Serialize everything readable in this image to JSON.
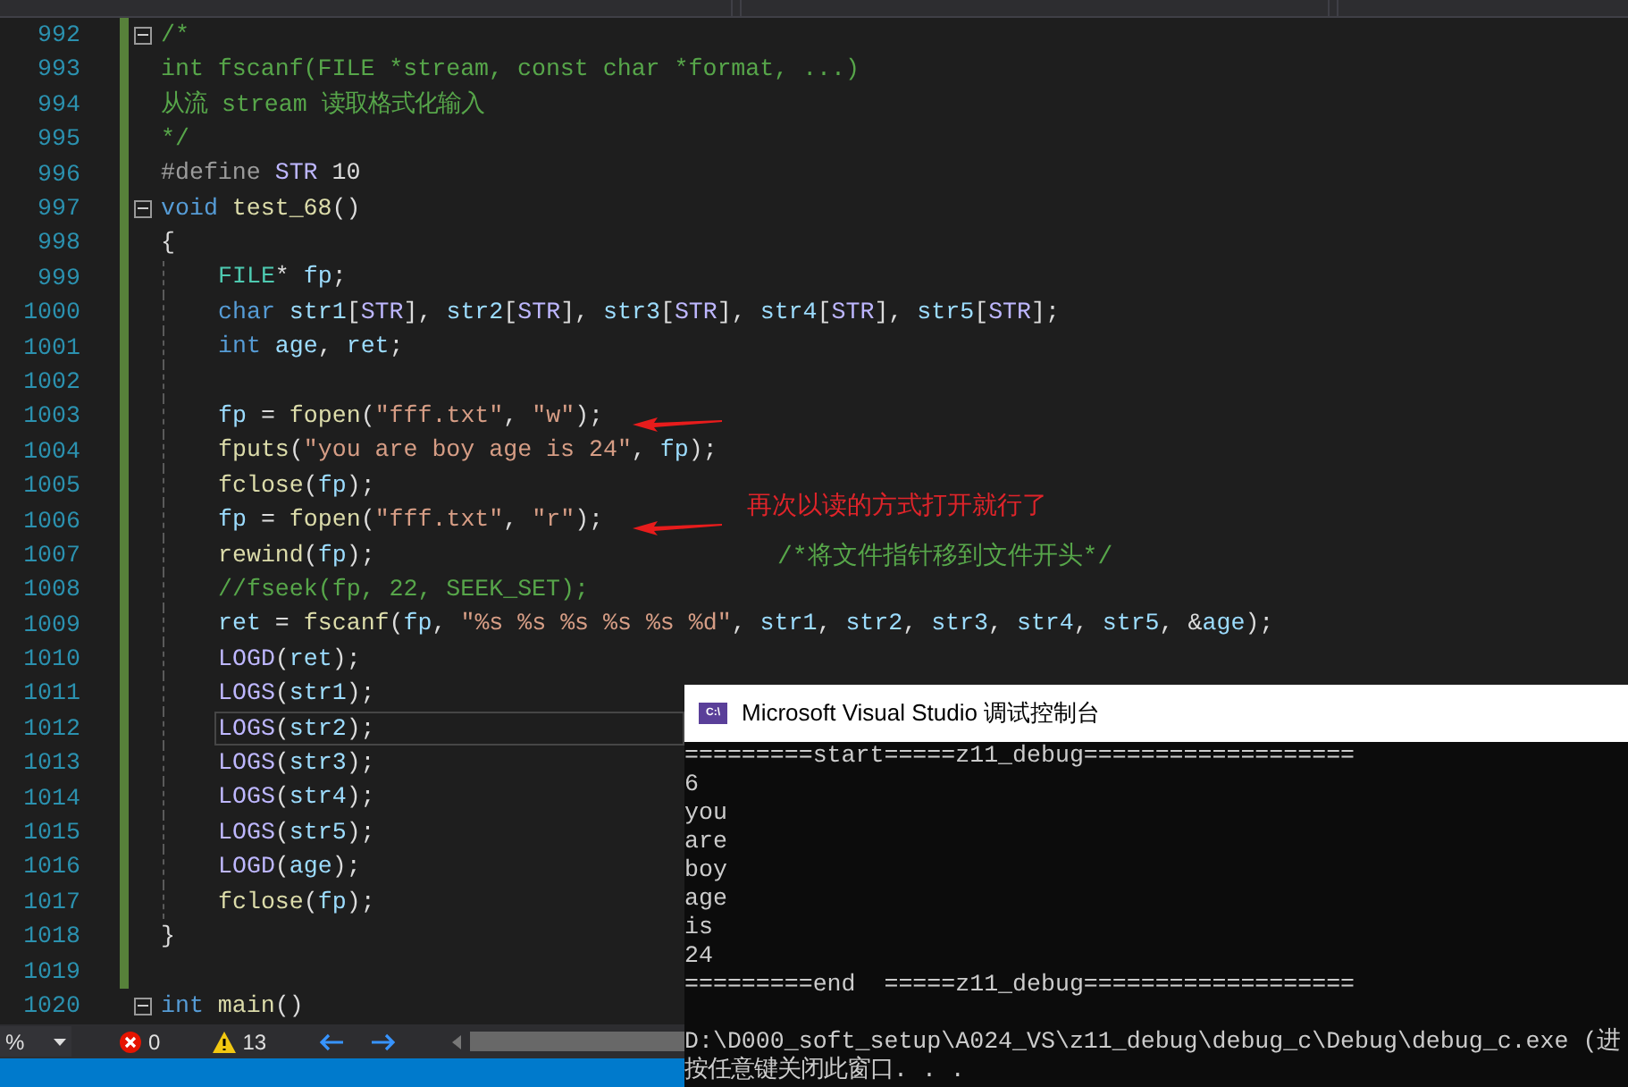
{
  "editor": {
    "lines": [
      {
        "number": "992",
        "modified": true,
        "fold": true,
        "current": false,
        "tokens": [
          {
            "kind": "comment",
            "text": "/*"
          }
        ]
      },
      {
        "number": "993",
        "modified": true,
        "fold": false,
        "current": false,
        "tokens": [
          {
            "kind": "comment",
            "text": "int fscanf(FILE *stream, const char *format, ...)"
          }
        ]
      },
      {
        "number": "994",
        "modified": true,
        "fold": false,
        "current": false,
        "tokens": [
          {
            "kind": "comment",
            "text": "从流 stream 读取格式化输入"
          }
        ]
      },
      {
        "number": "995",
        "modified": true,
        "fold": false,
        "current": false,
        "tokens": [
          {
            "kind": "comment",
            "text": "*/"
          }
        ]
      },
      {
        "number": "996",
        "modified": true,
        "fold": false,
        "current": false,
        "tokens": [
          {
            "kind": "preprocessor",
            "text": "#define"
          },
          {
            "kind": "macro",
            "text": " STR"
          },
          {
            "kind": "punct",
            "text": " 10"
          }
        ]
      },
      {
        "number": "997",
        "modified": true,
        "fold": true,
        "current": false,
        "tokens": [
          {
            "kind": "keyword",
            "text": "void"
          },
          {
            "kind": "function",
            "text": " test_68"
          },
          {
            "kind": "punct",
            "text": "()"
          }
        ]
      },
      {
        "number": "998",
        "modified": true,
        "fold": false,
        "current": false,
        "tokens": [
          {
            "kind": "punct",
            "text": "{"
          }
        ],
        "children": [
          {
            "number": "999",
            "modified": true,
            "fold": false,
            "current": false,
            "tokens": [
              {
                "kind": "type",
                "text": "FILE"
              },
              {
                "kind": "punct",
                "text": "* "
              },
              {
                "kind": "variable",
                "text": "fp"
              },
              {
                "kind": "punct",
                "text": ";"
              }
            ]
          },
          {
            "number": "1000",
            "modified": true,
            "fold": false,
            "current": false,
            "tokens": [
              {
                "kind": "keyword",
                "text": "char"
              },
              {
                "kind": "variable",
                "text": " str1"
              },
              {
                "kind": "punct",
                "text": "["
              },
              {
                "kind": "macro",
                "text": "STR"
              },
              {
                "kind": "punct",
                "text": "], "
              },
              {
                "kind": "variable",
                "text": "str2"
              },
              {
                "kind": "punct",
                "text": "["
              },
              {
                "kind": "macro",
                "text": "STR"
              },
              {
                "kind": "punct",
                "text": "], "
              },
              {
                "kind": "variable",
                "text": "str3"
              },
              {
                "kind": "punct",
                "text": "["
              },
              {
                "kind": "macro",
                "text": "STR"
              },
              {
                "kind": "punct",
                "text": "], "
              },
              {
                "kind": "variable",
                "text": "str4"
              },
              {
                "kind": "punct",
                "text": "["
              },
              {
                "kind": "macro",
                "text": "STR"
              },
              {
                "kind": "punct",
                "text": "], "
              },
              {
                "kind": "variable",
                "text": "str5"
              },
              {
                "kind": "punct",
                "text": "["
              },
              {
                "kind": "macro",
                "text": "STR"
              },
              {
                "kind": "punct",
                "text": "];"
              }
            ]
          },
          {
            "number": "1001",
            "modified": true,
            "fold": false,
            "current": false,
            "tokens": [
              {
                "kind": "keyword",
                "text": "int"
              },
              {
                "kind": "variable",
                "text": " age"
              },
              {
                "kind": "punct",
                "text": ", "
              },
              {
                "kind": "variable",
                "text": "ret"
              },
              {
                "kind": "punct",
                "text": ";"
              }
            ]
          },
          {
            "number": "1002",
            "modified": true,
            "fold": false,
            "current": false
          },
          {
            "number": "1003",
            "modified": true,
            "fold": false,
            "current": false,
            "tokens": [
              {
                "kind": "variable",
                "text": "fp"
              },
              {
                "kind": "punct",
                "text": " = "
              },
              {
                "kind": "function",
                "text": "fopen"
              },
              {
                "kind": "punct",
                "text": "("
              },
              {
                "kind": "string",
                "text": "\"fff.txt\""
              },
              {
                "kind": "punct",
                "text": ", "
              },
              {
                "kind": "string",
                "text": "\"w\""
              },
              {
                "kind": "punct",
                "text": ");"
              }
            ]
          },
          {
            "number": "1004",
            "modified": true,
            "fold": false,
            "current": false,
            "tokens": [
              {
                "kind": "function",
                "text": "fputs"
              },
              {
                "kind": "punct",
                "text": "("
              },
              {
                "kind": "string",
                "text": "\"you are boy age is 24\""
              },
              {
                "kind": "punct",
                "text": ", "
              },
              {
                "kind": "variable",
                "text": "fp"
              },
              {
                "kind": "punct",
                "text": ");"
              }
            ]
          },
          {
            "number": "1005",
            "modified": true,
            "fold": false,
            "current": false,
            "tokens": [
              {
                "kind": "function",
                "text": "fclose"
              },
              {
                "kind": "punct",
                "text": "("
              },
              {
                "kind": "variable",
                "text": "fp"
              },
              {
                "kind": "punct",
                "text": ");"
              }
            ]
          },
          {
            "number": "1006",
            "modified": true,
            "fold": false,
            "current": false,
            "tokens": [
              {
                "kind": "variable",
                "text": "fp"
              },
              {
                "kind": "punct",
                "text": " = "
              },
              {
                "kind": "function",
                "text": "fopen"
              },
              {
                "kind": "punct",
                "text": "("
              },
              {
                "kind": "string",
                "text": "\"fff.txt\""
              },
              {
                "kind": "punct",
                "text": ", "
              },
              {
                "kind": "string",
                "text": "\"r\""
              },
              {
                "kind": "punct",
                "text": ");"
              }
            ]
          },
          {
            "number": "1007",
            "modified": true,
            "fold": false,
            "current": false,
            "tokens": [
              {
                "kind": "function",
                "text": "rewind"
              },
              {
                "kind": "punct",
                "text": "("
              },
              {
                "kind": "variable",
                "text": "fp"
              },
              {
                "kind": "punct",
                "text": ");"
              }
            ]
          },
          {
            "number": "1008",
            "modified": true,
            "fold": false,
            "current": false,
            "tokens": [
              {
                "kind": "comment",
                "text": "//fseek(fp, 22, SEEK_SET);"
              }
            ]
          },
          {
            "number": "1009",
            "modified": true,
            "fold": false,
            "current": false,
            "tokens": [
              {
                "kind": "variable",
                "text": "ret"
              },
              {
                "kind": "punct",
                "text": " = "
              },
              {
                "kind": "function",
                "text": "fscanf"
              },
              {
                "kind": "punct",
                "text": "("
              },
              {
                "kind": "variable",
                "text": "fp"
              },
              {
                "kind": "punct",
                "text": ", "
              },
              {
                "kind": "string",
                "text": "\"%s %s %s %s %s %d\""
              },
              {
                "kind": "punct",
                "text": ", "
              },
              {
                "kind": "variable",
                "text": "str1"
              },
              {
                "kind": "punct",
                "text": ", "
              },
              {
                "kind": "variable",
                "text": "str2"
              },
              {
                "kind": "punct",
                "text": ", "
              },
              {
                "kind": "variable",
                "text": "str3"
              },
              {
                "kind": "punct",
                "text": ", "
              },
              {
                "kind": "variable",
                "text": "str4"
              },
              {
                "kind": "punct",
                "text": ", "
              },
              {
                "kind": "variable",
                "text": "str5"
              },
              {
                "kind": "punct",
                "text": ", &"
              },
              {
                "kind": "variable",
                "text": "age"
              },
              {
                "kind": "punct",
                "text": ");"
              }
            ]
          },
          {
            "number": "1010",
            "modified": true,
            "fold": false,
            "current": false,
            "tokens": [
              {
                "kind": "macro",
                "text": "LOGD"
              },
              {
                "kind": "punct",
                "text": "("
              },
              {
                "kind": "variable",
                "text": "ret"
              },
              {
                "kind": "punct",
                "text": ");"
              }
            ]
          },
          {
            "number": "1011",
            "modified": true,
            "fold": false,
            "current": false,
            "tokens": [
              {
                "kind": "macro",
                "text": "LOGS"
              },
              {
                "kind": "punct",
                "text": "("
              },
              {
                "kind": "variable",
                "text": "str1"
              },
              {
                "kind": "punct",
                "text": ");"
              }
            ]
          },
          {
            "number": "1012",
            "modified": true,
            "fold": false,
            "current": true,
            "tokens": [
              {
                "kind": "macro",
                "text": "LOGS"
              },
              {
                "kind": "punct",
                "text": "("
              },
              {
                "kind": "variable",
                "text": "str2"
              },
              {
                "kind": "punct",
                "text": ");"
              }
            ]
          },
          {
            "number": "1013",
            "modified": true,
            "fold": false,
            "current": false,
            "tokens": [
              {
                "kind": "macro",
                "text": "LOGS"
              },
              {
                "kind": "punct",
                "text": "("
              },
              {
                "kind": "variable",
                "text": "str3"
              },
              {
                "kind": "punct",
                "text": ");"
              }
            ]
          },
          {
            "number": "1014",
            "modified": true,
            "fold": false,
            "current": false,
            "tokens": [
              {
                "kind": "macro",
                "text": "LOGS"
              },
              {
                "kind": "punct",
                "text": "("
              },
              {
                "kind": "variable",
                "text": "str4"
              },
              {
                "kind": "punct",
                "text": ");"
              }
            ]
          },
          {
            "number": "1015",
            "modified": true,
            "fold": false,
            "current": false,
            "tokens": [
              {
                "kind": "macro",
                "text": "LOGS"
              },
              {
                "kind": "punct",
                "text": "("
              },
              {
                "kind": "variable",
                "text": "str5"
              },
              {
                "kind": "punct",
                "text": ");"
              }
            ]
          },
          {
            "number": "1016",
            "modified": true,
            "fold": false,
            "current": false,
            "tokens": [
              {
                "kind": "macro",
                "text": "LOGD"
              },
              {
                "kind": "punct",
                "text": "("
              },
              {
                "kind": "variable",
                "text": "age"
              },
              {
                "kind": "punct",
                "text": ");"
              }
            ]
          },
          {
            "number": "1017",
            "modified": true,
            "fold": false,
            "current": false,
            "tokens": [
              {
                "kind": "function",
                "text": "fclose"
              },
              {
                "kind": "punct",
                "text": "("
              },
              {
                "kind": "variable",
                "text": "fp"
              },
              {
                "kind": "punct",
                "text": ");"
              }
            ]
          }
        ]
      },
      {
        "number": "1018",
        "modified": true,
        "fold": false,
        "current": false,
        "tokens": [
          {
            "kind": "punct",
            "text": "}"
          }
        ]
      },
      {
        "number": "1019",
        "modified": true,
        "fold": false,
        "current": false
      },
      {
        "number": "1020",
        "modified": false,
        "fold": true,
        "current": false,
        "tokens": [
          {
            "kind": "keyword",
            "text": "int"
          },
          {
            "kind": "function",
            "text": " main"
          },
          {
            "kind": "punct",
            "text": "()"
          }
        ]
      }
    ],
    "annotations": [
      {
        "kind": "arrow"
      },
      {
        "kind": "arrow"
      },
      {
        "kind": "note",
        "text": "再次以读的方式打开就行了",
        "color": "#e0242a"
      },
      {
        "kind": "note",
        "text": "/*将文件指针移到文件开头*/",
        "color": "#57a64a"
      }
    ]
  },
  "status_bar": {
    "zoom": "%",
    "errors": "0",
    "warnings": "13"
  },
  "console": {
    "title": "Microsoft Visual Studio 调试控制台",
    "icon_text": "C:\\",
    "output": [
      "=========start=====z11_debug===================",
      "6",
      "you",
      "are",
      "boy",
      "age",
      "is",
      "24",
      "=========end  =====z11_debug==================="
    ],
    "footer": [
      "D:\\D000_soft_setup\\A024_VS\\z11_debug\\debug_c\\Debug\\debug_c.exe (进",
      "按任意键关闭此窗口. . ."
    ]
  }
}
